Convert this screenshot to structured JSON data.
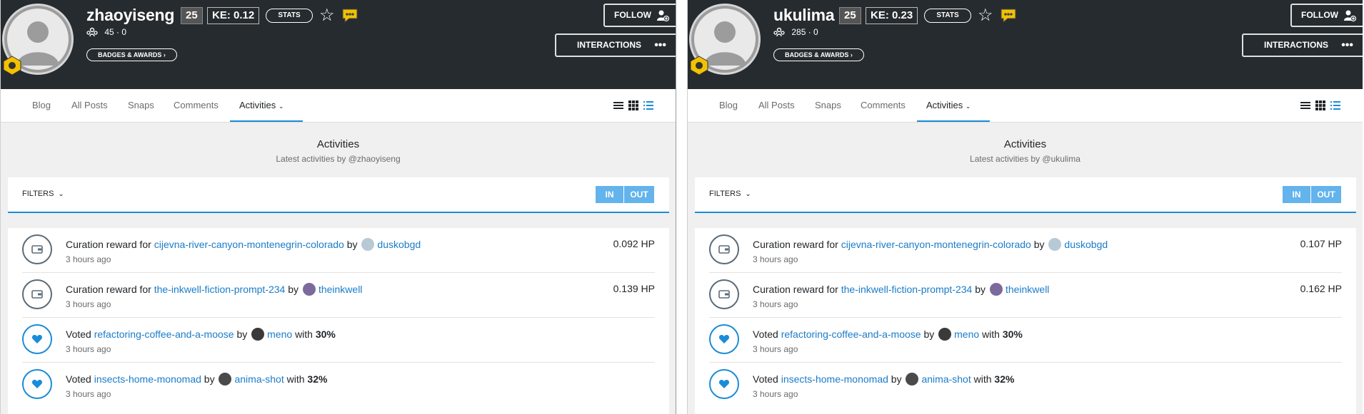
{
  "panels": [
    {
      "username": "zhaoyiseng",
      "reputation": "25",
      "ke": "KE: 0.12",
      "stats_label": "STATS",
      "followers": "45 · 0",
      "badges_label": "BADGES & AWARDS",
      "follow_label": "FOLLOW",
      "interactions_label": "INTERACTIONS",
      "tabs": [
        "Blog",
        "All Posts",
        "Snaps",
        "Comments",
        "Activities"
      ],
      "page_title": "Activities",
      "page_subtitle": "Latest activities by @zhaoyiseng",
      "filters_label": "FILTERS",
      "in_label": "IN",
      "out_label": "OUT",
      "activities": [
        {
          "prefix": "Curation reward for",
          "post": "cijevna-river-canyon-montenegrin-colorado",
          "by": "by",
          "author": "duskobgd",
          "suffix": "",
          "pct": "",
          "time": "3 hours ago",
          "amount": "0.092 HP",
          "icon": "wallet-icon"
        },
        {
          "prefix": "Curation reward for",
          "post": "the-inkwell-fiction-prompt-234",
          "by": "by",
          "author": "theinkwell",
          "suffix": "",
          "pct": "",
          "time": "3 hours ago",
          "amount": "0.139 HP",
          "icon": "wallet-icon"
        },
        {
          "prefix": "Voted",
          "post": "refactoring-coffee-and-a-moose",
          "by": "by",
          "author": "meno",
          "suffix": "with",
          "pct": "30%",
          "time": "3 hours ago",
          "amount": "",
          "icon": "heart-icon"
        },
        {
          "prefix": "Voted",
          "post": "insects-home-monomad",
          "by": "by",
          "author": "anima-shot",
          "suffix": "with",
          "pct": "32%",
          "time": "3 hours ago",
          "amount": "",
          "icon": "heart-icon"
        }
      ]
    },
    {
      "username": "ukulima",
      "reputation": "25",
      "ke": "KE: 0.23",
      "stats_label": "STATS",
      "followers": "285 · 0",
      "badges_label": "BADGES & AWARDS",
      "follow_label": "FOLLOW",
      "interactions_label": "INTERACTIONS",
      "tabs": [
        "Blog",
        "All Posts",
        "Snaps",
        "Comments",
        "Activities"
      ],
      "page_title": "Activities",
      "page_subtitle": "Latest activities by @ukulima",
      "filters_label": "FILTERS",
      "in_label": "IN",
      "out_label": "OUT",
      "activities": [
        {
          "prefix": "Curation reward for",
          "post": "cijevna-river-canyon-montenegrin-colorado",
          "by": "by",
          "author": "duskobgd",
          "suffix": "",
          "pct": "",
          "time": "3 hours ago",
          "amount": "0.107 HP",
          "icon": "wallet-icon"
        },
        {
          "prefix": "Curation reward for",
          "post": "the-inkwell-fiction-prompt-234",
          "by": "by",
          "author": "theinkwell",
          "suffix": "",
          "pct": "",
          "time": "3 hours ago",
          "amount": "0.162 HP",
          "icon": "wallet-icon"
        },
        {
          "prefix": "Voted",
          "post": "refactoring-coffee-and-a-moose",
          "by": "by",
          "author": "meno",
          "suffix": "with",
          "pct": "30%",
          "time": "3 hours ago",
          "amount": "",
          "icon": "heart-icon"
        },
        {
          "prefix": "Voted",
          "post": "insects-home-monomad",
          "by": "by",
          "author": "anima-shot",
          "suffix": "with",
          "pct": "32%",
          "time": "3 hours ago",
          "amount": "",
          "icon": "heart-icon"
        }
      ]
    }
  ],
  "colors": {
    "header_bg": "#262b2f",
    "accent": "#1a8cd8",
    "button_blue": "#63b3ed",
    "link": "#1a7cc9"
  }
}
